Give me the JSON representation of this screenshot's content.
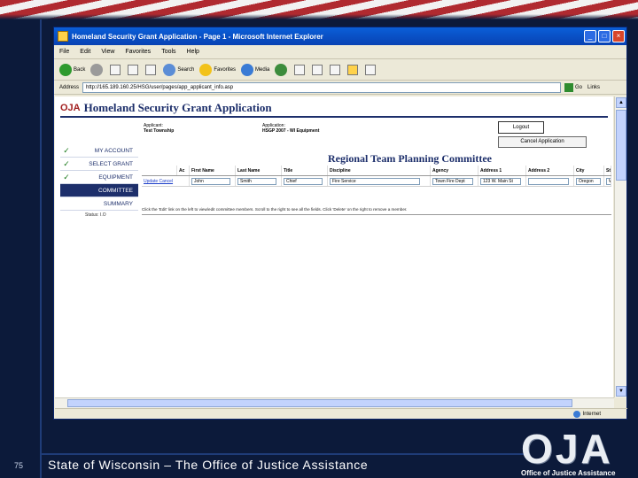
{
  "slide": {
    "number": "75",
    "footer": "State of Wisconsin – The Office of Justice Assistance",
    "logo_letters": "OJA",
    "logo_subtitle": "Office of Justice Assistance"
  },
  "browser": {
    "title": "Homeland Security Grant Application - Page 1 - Microsoft Internet Explorer",
    "menu": [
      "File",
      "Edit",
      "View",
      "Favorites",
      "Tools",
      "Help"
    ],
    "toolbar": {
      "back": "Back",
      "search": "Search",
      "favorites": "Favorites",
      "media": "Media"
    },
    "address_label": "Address",
    "address_value": "http://165.189.160.25/HSG/user/pages/app_applicant_info.asp",
    "go_label": "Go",
    "links_label": "Links",
    "status_zone": "Internet"
  },
  "app": {
    "logo": "OJA",
    "title": "Homeland Security Grant Application",
    "applicant_label": "Applicant:",
    "applicant_value": "Test Township",
    "application_label": "Application:",
    "application_value": "HSGP 2007 - WI Equipment",
    "logout_label": "Logout",
    "cancel_label": "Cancel Application",
    "nav": [
      {
        "label": "MY ACCOUNT",
        "done": true
      },
      {
        "label": "SELECT GRANT",
        "done": true
      },
      {
        "label": "EQUIPMENT",
        "done": true
      },
      {
        "label": "COMMITTEE",
        "done": false,
        "active": true
      },
      {
        "label": "SUMMARY",
        "done": false
      }
    ],
    "nav_status": "Status: I.O",
    "committee_title": "Regional Team Planning Committee",
    "columns": [
      "",
      "Ac",
      "First Name",
      "Last Name",
      "Title",
      "Discipline",
      "Agency",
      "Address 1",
      "Address 2",
      "City",
      "St"
    ],
    "row": {
      "action": "Update Cancel",
      "first_name": "John",
      "last_name": "Smith",
      "title": "Chief",
      "discipline": "Fire Service",
      "agency": "Town Fire Dept",
      "address1": "123 W. Main St",
      "address2": "",
      "city": "Oregon",
      "state": "WI"
    },
    "note": "Click the 'Edit' link on the left to view/edit committee members. Scroll to the right to see all the fields. Click 'Delete' on the right to remove a member."
  }
}
